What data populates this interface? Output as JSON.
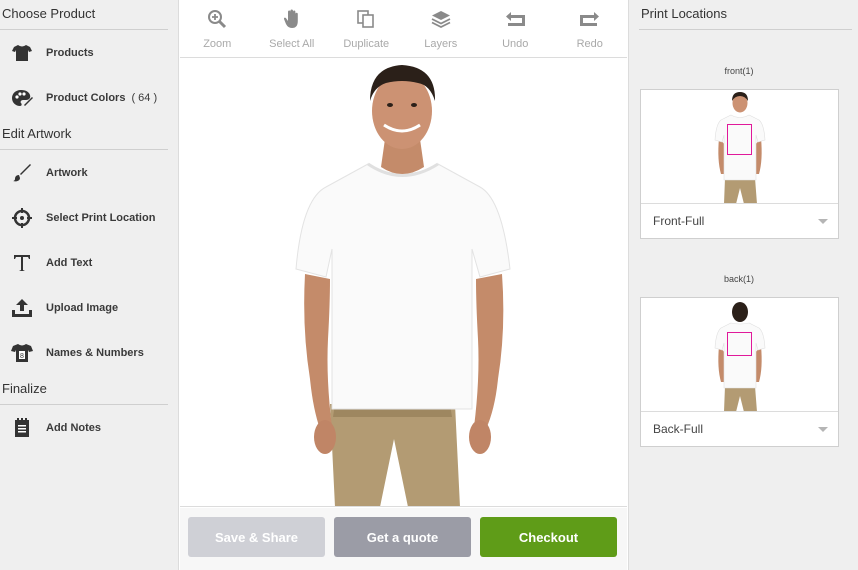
{
  "sidebar": {
    "sections": [
      {
        "title": "Choose Product"
      },
      {
        "title": "Edit Artwork"
      },
      {
        "title": "Finalize"
      }
    ],
    "items": [
      {
        "label": "Products",
        "icon": "tshirt-icon"
      },
      {
        "label": "Product Colors",
        "count": "( 64 )",
        "icon": "palette-icon"
      },
      {
        "label": "Artwork",
        "icon": "brush-icon"
      },
      {
        "label": "Select Print Location",
        "icon": "crosshair-icon"
      },
      {
        "label": "Add Text",
        "icon": "text-icon"
      },
      {
        "label": "Upload Image",
        "icon": "upload-icon"
      },
      {
        "label": "Names & Numbers",
        "icon": "jersey-number-icon"
      },
      {
        "label": "Add Notes",
        "icon": "notes-icon"
      }
    ]
  },
  "toolbar": {
    "tools": [
      {
        "label": "Zoom",
        "icon": "zoom-icon"
      },
      {
        "label": "Select All",
        "icon": "hand-icon"
      },
      {
        "label": "Duplicate",
        "icon": "duplicate-icon"
      },
      {
        "label": "Layers",
        "icon": "layers-icon"
      },
      {
        "label": "Undo",
        "icon": "undo-icon"
      },
      {
        "label": "Redo",
        "icon": "redo-icon"
      }
    ]
  },
  "actions": {
    "save": "Save & Share",
    "quote": "Get a quote",
    "checkout": "Checkout"
  },
  "print_locations": {
    "title": "Print Locations",
    "locations": [
      {
        "label": "front(1)",
        "selected": "Front-Full"
      },
      {
        "label": "back(1)",
        "selected": "Back-Full"
      }
    ]
  },
  "colors": {
    "checkout": "#5f9c18",
    "quote": "#9b9ca6",
    "save": "#cfd0d6",
    "print_box": "#e0199a"
  }
}
